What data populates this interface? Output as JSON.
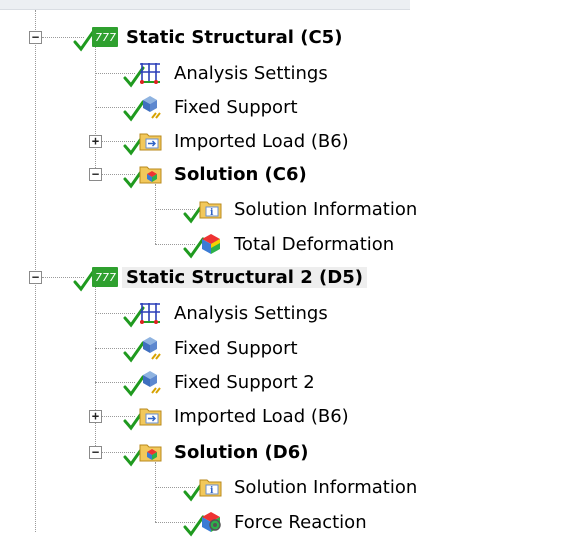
{
  "tree": {
    "items": [
      {
        "label": "Static Structural (C5)",
        "icon": "static-structural-icon",
        "bold": true,
        "expander": "−"
      },
      {
        "label": "Analysis Settings",
        "icon": "analysis-settings-icon"
      },
      {
        "label": "Fixed Support",
        "icon": "fixed-support-icon"
      },
      {
        "label": "Imported Load (B6)",
        "icon": "imported-load-folder-icon",
        "expander": "+"
      },
      {
        "label": "Solution (C6)",
        "icon": "solution-icon",
        "bold": true,
        "expander": "−"
      },
      {
        "label": "Solution Information",
        "icon": "solution-information-icon"
      },
      {
        "label": "Total Deformation",
        "icon": "total-deformation-icon"
      },
      {
        "label": "Static Structural 2 (D5)",
        "icon": "static-structural-icon",
        "bold": true,
        "selected": true,
        "expander": "−"
      },
      {
        "label": "Analysis Settings",
        "icon": "analysis-settings-icon"
      },
      {
        "label": "Fixed Support",
        "icon": "fixed-support-icon"
      },
      {
        "label": "Fixed Support 2",
        "icon": "fixed-support-icon"
      },
      {
        "label": "Imported Load (B6)",
        "icon": "imported-load-folder-icon",
        "expander": "+"
      },
      {
        "label": "Solution (D6)",
        "icon": "solution-icon",
        "bold": true,
        "expander": "−"
      },
      {
        "label": "Solution Information",
        "icon": "solution-information-icon"
      },
      {
        "label": "Force Reaction",
        "icon": "force-reaction-icon"
      }
    ]
  },
  "colors": {
    "check": "#1f9a1f",
    "selected_bg": "#eeeeee"
  }
}
